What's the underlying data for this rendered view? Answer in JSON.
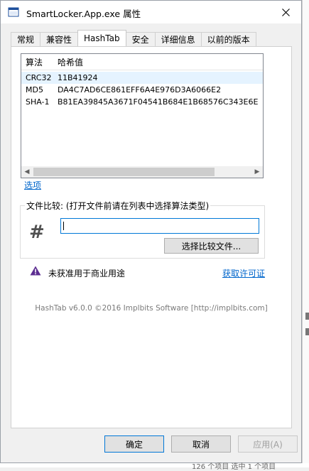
{
  "window": {
    "title": "SmartLocker.App.exe 属性"
  },
  "tabs": [
    {
      "label": "常规",
      "active": false
    },
    {
      "label": "兼容性",
      "active": false
    },
    {
      "label": "HashTab",
      "active": true
    },
    {
      "label": "安全",
      "active": false
    },
    {
      "label": "详细信息",
      "active": false
    },
    {
      "label": "以前的版本",
      "active": false
    }
  ],
  "hash_list": {
    "columns": [
      "算法",
      "哈希值"
    ],
    "rows": [
      {
        "algo": "CRC32",
        "value": "11B41924"
      },
      {
        "algo": "MD5",
        "value": "DA4C7AD6CE861EFF6A4E976D3A6066E2"
      },
      {
        "algo": "SHA-1",
        "value": "B81EA39845A3671F04541B684E1B68576C343E6E"
      }
    ]
  },
  "options_link": "选项",
  "compare": {
    "group_label": "文件比较: (打开文件前请在列表中选择算法类型)",
    "input_value": "",
    "button_label": "选择比较文件..."
  },
  "license": {
    "warning_text": "未获准用于商业用途",
    "link_text": "获取许可证"
  },
  "footer_text": "HashTab v6.0.0 ©2016 Implbits Software [http://implbits.com]",
  "buttons": {
    "ok": "确定",
    "cancel": "取消",
    "apply": "应用(A)"
  },
  "background_text": "126 个项目      选中 1 个项目",
  "colors": {
    "accent": "#0078d7",
    "link": "#0066cc",
    "warning": "#5c2d91"
  }
}
